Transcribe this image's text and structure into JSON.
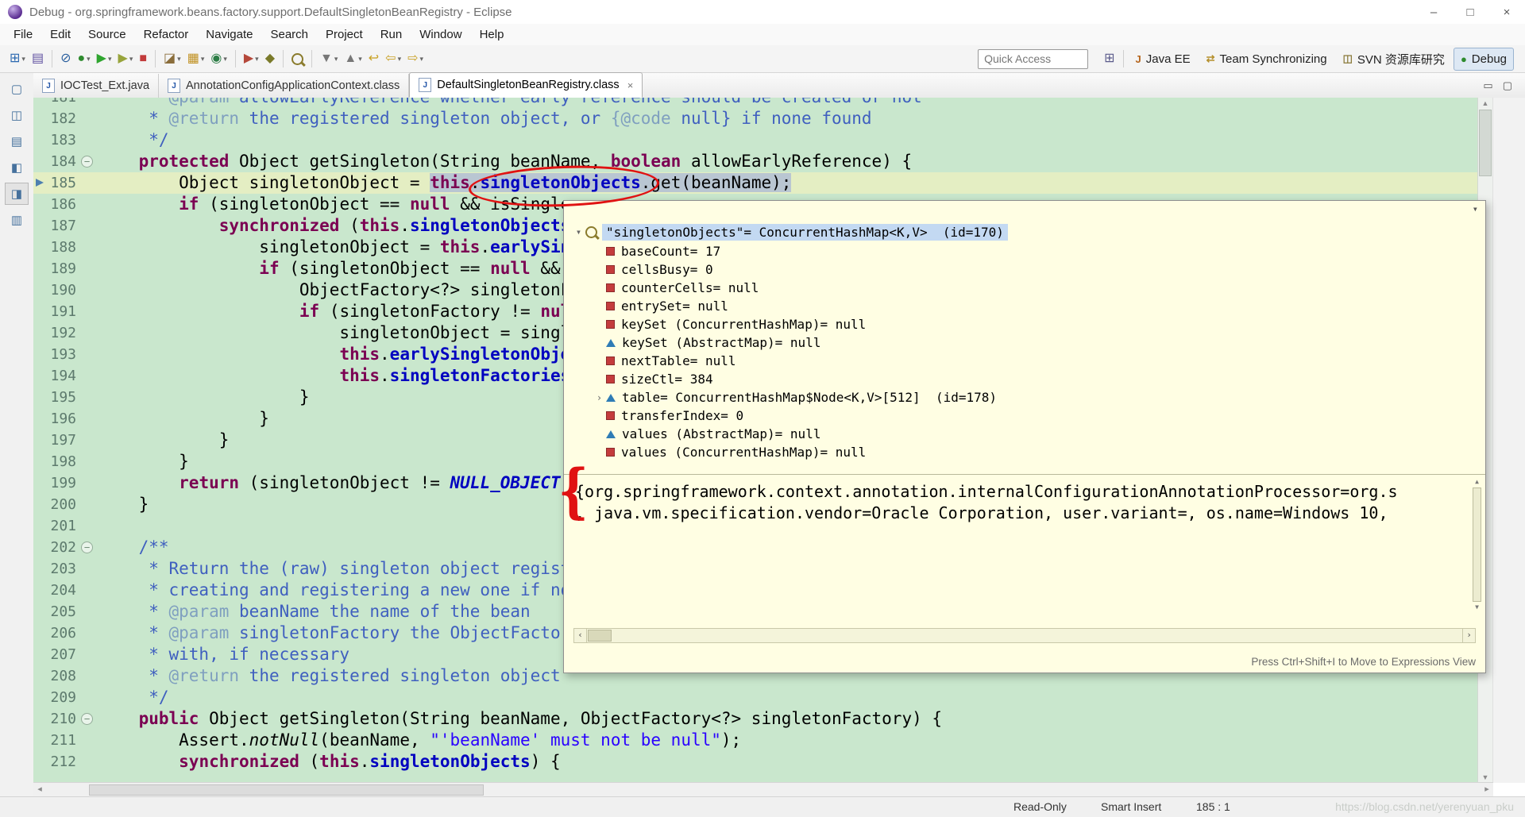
{
  "window": {
    "title": "Debug - org.springframework.beans.factory.support.DefaultSingletonBeanRegistry - Eclipse",
    "controls": [
      {
        "name": "minimize",
        "glyph": "–"
      },
      {
        "name": "maximize",
        "glyph": "□"
      },
      {
        "name": "close",
        "glyph": "×"
      }
    ]
  },
  "menu_bar": {
    "items": [
      "File",
      "Edit",
      "Source",
      "Refactor",
      "Navigate",
      "Search",
      "Project",
      "Run",
      "Window",
      "Help"
    ]
  },
  "toolbar": {
    "quick_access": "Quick Access",
    "items": [
      {
        "name": "new-wizard",
        "glyph": "⊞",
        "color": "#2a68b0",
        "dropdown": true
      },
      {
        "name": "save",
        "glyph": "▤",
        "color": "#5f4fa0"
      },
      {
        "sep": true
      },
      {
        "name": "skip-all-breakpoints",
        "glyph": "⊘",
        "color": "#2a5f9e"
      },
      {
        "name": "debug",
        "glyph": "●",
        "color": "#2e8b2e",
        "dropdown": true
      },
      {
        "name": "run",
        "glyph": "▶",
        "color": "#2fa52f",
        "dropdown": true
      },
      {
        "name": "coverage",
        "glyph": "▶",
        "color": "#98a43c",
        "dropdown": true
      },
      {
        "name": "terminate",
        "glyph": "■",
        "color": "#c23b3b"
      },
      {
        "sep": true
      },
      {
        "name": "new-java-project",
        "glyph": "◪",
        "color": "#8a6d3b",
        "dropdown": true
      },
      {
        "name": "new-package",
        "glyph": "▦",
        "color": "#c09020",
        "dropdown": true
      },
      {
        "name": "new-class",
        "glyph": "◉",
        "color": "#2d7d46",
        "dropdown": true
      },
      {
        "sep": true
      },
      {
        "name": "external-tools",
        "glyph": "▶",
        "color": "#b5483a",
        "dropdown": true
      },
      {
        "name": "ant-build",
        "glyph": "◆",
        "color": "#7a7a2a"
      },
      {
        "sep": true
      },
      {
        "name": "search",
        "css": "mag"
      },
      {
        "sep": true
      },
      {
        "name": "next-annotation",
        "glyph": "▼",
        "color": "#777777",
        "dropdown": true
      },
      {
        "name": "previous-annotation",
        "glyph": "▲",
        "color": "#777777",
        "dropdown": true
      },
      {
        "name": "last-edit-location",
        "glyph": "↩",
        "color": "#c9a227"
      },
      {
        "name": "back",
        "glyph": "⇦",
        "color": "#c9a227",
        "dropdown": true
      },
      {
        "name": "forward",
        "glyph": "⇨",
        "color": "#c9a227",
        "dropdown": true
      }
    ]
  },
  "perspectives": {
    "open_glyph": "⊞",
    "buttons": [
      {
        "name": "java-ee",
        "label": "Java EE",
        "glyph": "J",
        "color": "#b5651d",
        "active": false
      },
      {
        "name": "team-synchronizing",
        "label": "Team Synchronizing",
        "glyph": "⇄",
        "color": "#b5902d",
        "active": false
      },
      {
        "name": "svn",
        "label": "SVN 资源库研究",
        "glyph": "◫",
        "color": "#8a7a3a",
        "active": false
      },
      {
        "name": "debug",
        "label": "Debug",
        "glyph": "●",
        "color": "#2e8b2e",
        "active": true
      }
    ]
  },
  "tabs": {
    "minimize_glyph": "▭",
    "maximize_glyph": "▢",
    "items": [
      {
        "label": "IOCTest_Ext.java",
        "icon": "J",
        "active": false
      },
      {
        "label": "AnnotationConfigApplicationContext.class",
        "icon": "J",
        "active": false
      },
      {
        "label": "DefaultSingletonBeanRegistry.class",
        "icon": "J",
        "active": true,
        "close_glyph": "×"
      }
    ]
  },
  "sidebar": {
    "items": [
      {
        "name": "restore-views-icon",
        "glyph": "▢",
        "active": false
      },
      {
        "name": "project-explorer-shortcut-icon",
        "glyph": "◫",
        "active": false
      },
      {
        "name": "debug-view-shortcut-icon",
        "glyph": "▤",
        "active": false
      },
      {
        "name": "servers-view-shortcut-icon",
        "glyph": "◧",
        "active": false
      },
      {
        "name": "breakpoints-view-shortcut-icon",
        "glyph": "◨",
        "active": true
      },
      {
        "name": "expressions-view-shortcut-icon",
        "glyph": "▥",
        "active": false
      }
    ]
  },
  "editor": {
    "current_line": 185,
    "lines": [
      {
        "n": 181,
        "segs": [
          {
            "t": "     * ",
            "s": "doc"
          },
          {
            "t": "@param",
            "s": "tag"
          },
          {
            "t": " allowEarlyReference whether early reference should be created or not",
            "s": "doc"
          }
        ]
      },
      {
        "n": 182,
        "segs": [
          {
            "t": "     * ",
            "s": "doc"
          },
          {
            "t": "@return",
            "s": "tag"
          },
          {
            "t": " the registered singleton object, or ",
            "s": "doc"
          },
          {
            "t": "{@code",
            "s": "tag"
          },
          {
            "t": " null}",
            "s": "doc"
          },
          {
            "t": " if none found",
            "s": "doc"
          }
        ]
      },
      {
        "n": 183,
        "segs": [
          {
            "t": "     */",
            "s": "doc"
          }
        ]
      },
      {
        "n": 184,
        "fold": true,
        "segs": [
          {
            "t": "    ",
            "s": "d"
          },
          {
            "t": "protected",
            "s": "kw"
          },
          {
            "t": " Object getSingleton(String beanName, ",
            "s": "d"
          },
          {
            "t": "boolean",
            "s": "kw"
          },
          {
            "t": " allowEarlyReference) {",
            "s": "d"
          }
        ]
      },
      {
        "n": 185,
        "cur": true,
        "segs": [
          {
            "t": "        Object singletonObject = ",
            "s": "d"
          },
          {
            "t": "this",
            "s": "kw sel"
          },
          {
            "t": ".",
            "s": "d sel"
          },
          {
            "t": "singletonObjects",
            "s": "fld sel"
          },
          {
            "t": ".get(beanName);",
            "s": "d sel"
          }
        ]
      },
      {
        "n": 186,
        "segs": [
          {
            "t": "        ",
            "s": "d"
          },
          {
            "t": "if",
            "s": "kw"
          },
          {
            "t": " (singletonObject == ",
            "s": "d"
          },
          {
            "t": "null",
            "s": "kw"
          },
          {
            "t": " && isSingle",
            "s": "d"
          }
        ]
      },
      {
        "n": 187,
        "segs": [
          {
            "t": "            ",
            "s": "d"
          },
          {
            "t": "synchronized",
            "s": "kw"
          },
          {
            "t": " (",
            "s": "d"
          },
          {
            "t": "this",
            "s": "kw"
          },
          {
            "t": ".",
            "s": "d"
          },
          {
            "t": "singletonObjects",
            "s": "fld"
          }
        ]
      },
      {
        "n": 188,
        "segs": [
          {
            "t": "                singletonObject = ",
            "s": "d"
          },
          {
            "t": "this",
            "s": "kw"
          },
          {
            "t": ".",
            "s": "d"
          },
          {
            "t": "earlySin",
            "s": "fld"
          }
        ]
      },
      {
        "n": 189,
        "segs": [
          {
            "t": "                ",
            "s": "d"
          },
          {
            "t": "if",
            "s": "kw"
          },
          {
            "t": " (singletonObject == ",
            "s": "d"
          },
          {
            "t": "null",
            "s": "kw"
          },
          {
            "t": " &&",
            "s": "d"
          }
        ]
      },
      {
        "n": 190,
        "segs": [
          {
            "t": "                    ObjectFactory<?> singletonF",
            "s": "d"
          }
        ]
      },
      {
        "n": 191,
        "segs": [
          {
            "t": "                    ",
            "s": "d"
          },
          {
            "t": "if",
            "s": "kw"
          },
          {
            "t": " (singletonFactory != ",
            "s": "d"
          },
          {
            "t": "nul",
            "s": "kw"
          }
        ]
      },
      {
        "n": 192,
        "segs": [
          {
            "t": "                        singletonObject = singl",
            "s": "d"
          }
        ]
      },
      {
        "n": 193,
        "segs": [
          {
            "t": "                        ",
            "s": "d"
          },
          {
            "t": "this",
            "s": "kw"
          },
          {
            "t": ".",
            "s": "d"
          },
          {
            "t": "earlySingletonObje",
            "s": "fld"
          }
        ]
      },
      {
        "n": 194,
        "segs": [
          {
            "t": "                        ",
            "s": "d"
          },
          {
            "t": "this",
            "s": "kw"
          },
          {
            "t": ".",
            "s": "d"
          },
          {
            "t": "singletonFactories",
            "s": "fld"
          }
        ]
      },
      {
        "n": 195,
        "segs": [
          {
            "t": "                    }",
            "s": "d"
          }
        ]
      },
      {
        "n": 196,
        "segs": [
          {
            "t": "                }",
            "s": "d"
          }
        ]
      },
      {
        "n": 197,
        "segs": [
          {
            "t": "            }",
            "s": "d"
          }
        ]
      },
      {
        "n": 198,
        "segs": [
          {
            "t": "        }",
            "s": "d"
          }
        ]
      },
      {
        "n": 199,
        "segs": [
          {
            "t": "        ",
            "s": "d"
          },
          {
            "t": "return",
            "s": "kw"
          },
          {
            "t": " (singletonObject != ",
            "s": "d"
          },
          {
            "t": "NULL_OBJECT",
            "s": "con"
          }
        ]
      },
      {
        "n": 200,
        "segs": [
          {
            "t": "    }",
            "s": "d"
          }
        ]
      },
      {
        "n": 201,
        "segs": []
      },
      {
        "n": 202,
        "fold": true,
        "segs": [
          {
            "t": "    /**",
            "s": "doc"
          }
        ]
      },
      {
        "n": 203,
        "segs": [
          {
            "t": "     * Return the (raw) singleton object regist",
            "s": "doc"
          }
        ]
      },
      {
        "n": 204,
        "segs": [
          {
            "t": "     * creating and registering a new one if no",
            "s": "doc"
          }
        ]
      },
      {
        "n": 205,
        "segs": [
          {
            "t": "     * ",
            "s": "doc"
          },
          {
            "t": "@param",
            "s": "tag"
          },
          {
            "t": " beanName the name of the bean",
            "s": "doc"
          }
        ]
      },
      {
        "n": 206,
        "segs": [
          {
            "t": "     * ",
            "s": "doc"
          },
          {
            "t": "@param",
            "s": "tag"
          },
          {
            "t": " singletonFactory the ObjectFactor",
            "s": "doc"
          }
        ]
      },
      {
        "n": 207,
        "segs": [
          {
            "t": "     * with, if necessary",
            "s": "doc"
          }
        ]
      },
      {
        "n": 208,
        "segs": [
          {
            "t": "     * ",
            "s": "doc"
          },
          {
            "t": "@return",
            "s": "tag"
          },
          {
            "t": " the registered singleton object",
            "s": "doc"
          }
        ]
      },
      {
        "n": 209,
        "segs": [
          {
            "t": "     */",
            "s": "doc"
          }
        ]
      },
      {
        "n": 210,
        "fold": true,
        "segs": [
          {
            "t": "    ",
            "s": "d"
          },
          {
            "t": "public",
            "s": "kw"
          },
          {
            "t": " Object getSingleton(String beanName, ObjectFactory<?> singletonFactory) {",
            "s": "d"
          }
        ]
      },
      {
        "n": 211,
        "segs": [
          {
            "t": "        Assert.",
            "s": "d"
          },
          {
            "t": "notNull",
            "s": "itl"
          },
          {
            "t": "(beanName, ",
            "s": "d"
          },
          {
            "t": "\"'beanName' must not be null\"",
            "s": "str"
          },
          {
            "t": ");",
            "s": "d"
          }
        ]
      },
      {
        "n": 212,
        "segs": [
          {
            "t": "        ",
            "s": "d"
          },
          {
            "t": "synchronized",
            "s": "kw"
          },
          {
            "t": " (",
            "s": "d"
          },
          {
            "t": "this",
            "s": "kw"
          },
          {
            "t": ".",
            "s": "d"
          },
          {
            "t": "singletonObjects",
            "s": "fld"
          },
          {
            "t": ") {",
            "s": "d"
          }
        ]
      }
    ]
  },
  "popup": {
    "root_label": "\"singletonObjects\"= ConcurrentHashMap<K,V>  (id=170)",
    "items": [
      {
        "icon": "red",
        "label": "baseCount= 17"
      },
      {
        "icon": "red",
        "label": "cellsBusy= 0"
      },
      {
        "icon": "red",
        "label": "counterCells= null"
      },
      {
        "icon": "red",
        "label": "entrySet= null"
      },
      {
        "icon": "red",
        "label": "keySet (ConcurrentHashMap)= null"
      },
      {
        "icon": "tri",
        "label": "keySet (AbstractMap)= null"
      },
      {
        "icon": "red",
        "label": "nextTable= null"
      },
      {
        "icon": "red",
        "label": "sizeCtl= 384"
      },
      {
        "icon": "tri",
        "expander": true,
        "label": "table= ConcurrentHashMap$Node<K,V>[512]  (id=178)"
      },
      {
        "icon": "red",
        "label": "transferIndex= 0"
      },
      {
        "icon": "tri",
        "label": "values (AbstractMap)= null"
      },
      {
        "icon": "red",
        "label": "values (ConcurrentHashMap)= null"
      }
    ],
    "detail_lines": [
      "{org.springframework.context.annotation.internalConfigurationAnnotationProcessor=org.s",
      ", java.vm.specification.vendor=Oracle Corporation, user.variant=, os.name=Windows 10,"
    ],
    "hint": "Press Ctrl+Shift+I to Move to Expressions View"
  },
  "annotations": {
    "brace_glyph": "{"
  },
  "status_bar": {
    "read_only": "Read-Only",
    "smart_insert": "Smart Insert",
    "position": "185 : 1",
    "watermark": "https://blog.csdn.net/yerenyuan_pku"
  }
}
